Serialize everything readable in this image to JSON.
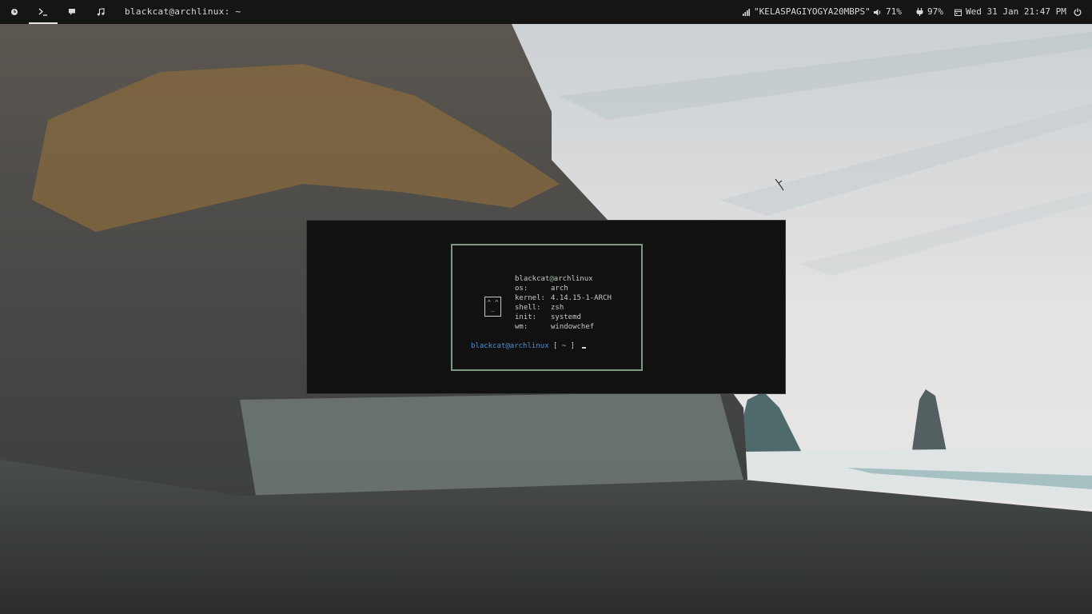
{
  "topbar": {
    "workspaces": [
      {
        "icon": "clock-icon"
      },
      {
        "icon": "terminal-icon"
      },
      {
        "icon": "chat-icon"
      },
      {
        "icon": "music-icon"
      }
    ],
    "window_title": "blackcat@archlinux: ~",
    "wifi": "\"KELASPAGIYOGYA20MBPS\"",
    "volume": "71%",
    "battery": "97%",
    "datetime": "Wed 31 Jan 21:47 PM"
  },
  "terminal": {
    "user": "blackcat",
    "at": "@",
    "host": "archlinux",
    "face_top": "^ ^",
    "face_mouth": "_",
    "info": [
      {
        "key": "os:",
        "value": "arch"
      },
      {
        "key": "kernel:",
        "value": "4.14.15-1-ARCH"
      },
      {
        "key": "shell:",
        "value": "zsh"
      },
      {
        "key": "init:",
        "value": "systemd"
      },
      {
        "key": "wm:",
        "value": "windowchef"
      }
    ],
    "prompt_user": "blackcat",
    "prompt_host": "archlinux",
    "prompt_suffix": " [ ~ ] "
  },
  "colors": {
    "bar_bg": "#151515",
    "terminal_bg": "#111111",
    "box_border": "#7f9a83",
    "prompt_blue": "#4a8fd6"
  }
}
